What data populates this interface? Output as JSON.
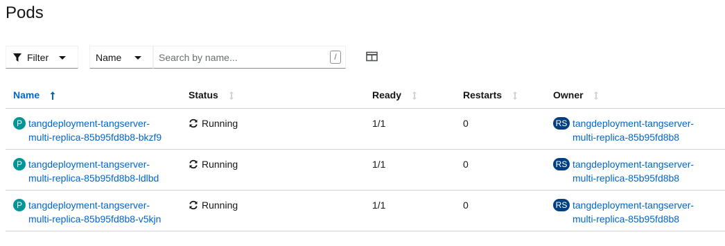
{
  "page": {
    "title": "Pods"
  },
  "toolbar": {
    "filter_label": "Filter",
    "name_select_value": "Name",
    "search_placeholder": "Search by name...",
    "search_value": "",
    "shortcut_key": "/"
  },
  "table": {
    "columns": [
      "Name",
      "Status",
      "Ready",
      "Restarts",
      "Owner"
    ],
    "rows": [
      {
        "badge": "P",
        "name_line1": "tangdeployment-tangserver-",
        "name_line2": "multi-replica-85b95fd8b8-bkzf9",
        "status": "Running",
        "ready": "1/1",
        "restarts": "0",
        "owner_badge": "RS",
        "owner_line1": "tangdeployment-tangserver-",
        "owner_line2": "multi-replica-85b95fd8b8"
      },
      {
        "badge": "P",
        "name_line1": "tangdeployment-tangserver-",
        "name_line2": "multi-replica-85b95fd8b8-ldlbd",
        "status": "Running",
        "ready": "1/1",
        "restarts": "0",
        "owner_badge": "RS",
        "owner_line1": "tangdeployment-tangserver-",
        "owner_line2": "multi-replica-85b95fd8b8"
      },
      {
        "badge": "P",
        "name_line1": "tangdeployment-tangserver-",
        "name_line2": "multi-replica-85b95fd8b8-v5kjn",
        "status": "Running",
        "ready": "1/1",
        "restarts": "0",
        "owner_badge": "RS",
        "owner_line1": "tangdeployment-tangserver-",
        "owner_line2": "multi-replica-85b95fd8b8"
      }
    ]
  },
  "colors": {
    "link": "#0066cc",
    "pod_badge": "#009596",
    "rs_badge": "#004080",
    "border": "#d2d2d2"
  },
  "icons": {
    "filter": "filter-icon",
    "caret": "caret-down-icon",
    "columns": "columns-icon",
    "sort": "sort-icon",
    "status": "sync-icon"
  }
}
